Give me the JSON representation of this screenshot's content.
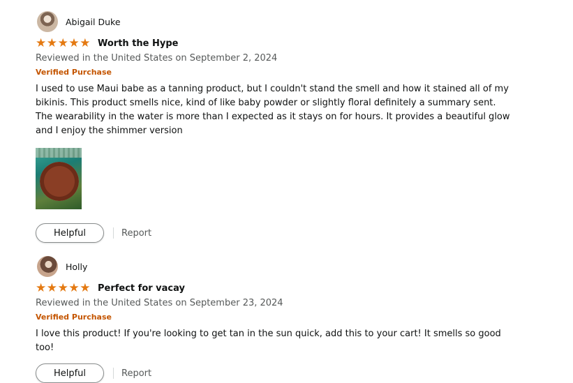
{
  "colors": {
    "star": "#e47911",
    "verified": "#c45500",
    "muted_text": "#565959"
  },
  "reviews": [
    {
      "reviewer": "Abigail Duke",
      "rating": 5,
      "title": "Worth the Hype",
      "date": "Reviewed in the United States on September 2, 2024",
      "verified": "Verified Purchase",
      "body": "I used to use Maui babe as a tanning product, but I couldn't stand the smell and how it stained all of my bikinis. This product smells nice, kind of like baby powder or slightly floral definitely a summary sent. The wearability in the water is more than I expected as it stays on for hours. It provides a beautiful glow and I enjoy the shimmer version",
      "helpful_label": "Helpful",
      "report_label": "Report"
    },
    {
      "reviewer": "Holly",
      "rating": 5,
      "title": "Perfect for vacay",
      "date": "Reviewed in the United States on September 23, 2024",
      "verified": "Verified Purchase",
      "body": "I love this product! If you're looking to get tan in the sun quick, add this to your cart! It smells so good too!",
      "helpful_label": "Helpful",
      "report_label": "Report"
    }
  ]
}
